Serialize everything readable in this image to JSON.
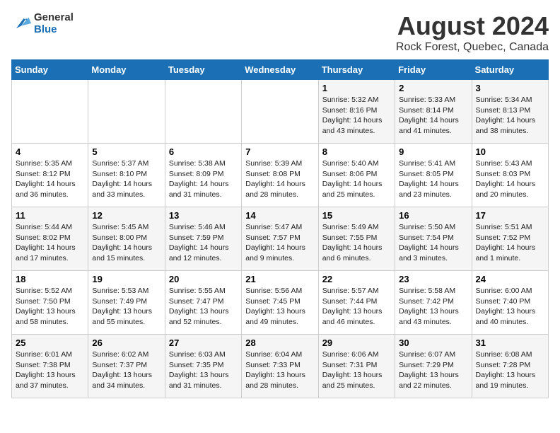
{
  "header": {
    "logo_line1": "General",
    "logo_line2": "Blue",
    "main_title": "August 2024",
    "subtitle": "Rock Forest, Quebec, Canada"
  },
  "days_of_week": [
    "Sunday",
    "Monday",
    "Tuesday",
    "Wednesday",
    "Thursday",
    "Friday",
    "Saturday"
  ],
  "weeks": [
    [
      {
        "day": "",
        "info": ""
      },
      {
        "day": "",
        "info": ""
      },
      {
        "day": "",
        "info": ""
      },
      {
        "day": "",
        "info": ""
      },
      {
        "day": "1",
        "info": "Sunrise: 5:32 AM\nSunset: 8:16 PM\nDaylight: 14 hours\nand 43 minutes."
      },
      {
        "day": "2",
        "info": "Sunrise: 5:33 AM\nSunset: 8:14 PM\nDaylight: 14 hours\nand 41 minutes."
      },
      {
        "day": "3",
        "info": "Sunrise: 5:34 AM\nSunset: 8:13 PM\nDaylight: 14 hours\nand 38 minutes."
      }
    ],
    [
      {
        "day": "4",
        "info": "Sunrise: 5:35 AM\nSunset: 8:12 PM\nDaylight: 14 hours\nand 36 minutes."
      },
      {
        "day": "5",
        "info": "Sunrise: 5:37 AM\nSunset: 8:10 PM\nDaylight: 14 hours\nand 33 minutes."
      },
      {
        "day": "6",
        "info": "Sunrise: 5:38 AM\nSunset: 8:09 PM\nDaylight: 14 hours\nand 31 minutes."
      },
      {
        "day": "7",
        "info": "Sunrise: 5:39 AM\nSunset: 8:08 PM\nDaylight: 14 hours\nand 28 minutes."
      },
      {
        "day": "8",
        "info": "Sunrise: 5:40 AM\nSunset: 8:06 PM\nDaylight: 14 hours\nand 25 minutes."
      },
      {
        "day": "9",
        "info": "Sunrise: 5:41 AM\nSunset: 8:05 PM\nDaylight: 14 hours\nand 23 minutes."
      },
      {
        "day": "10",
        "info": "Sunrise: 5:43 AM\nSunset: 8:03 PM\nDaylight: 14 hours\nand 20 minutes."
      }
    ],
    [
      {
        "day": "11",
        "info": "Sunrise: 5:44 AM\nSunset: 8:02 PM\nDaylight: 14 hours\nand 17 minutes."
      },
      {
        "day": "12",
        "info": "Sunrise: 5:45 AM\nSunset: 8:00 PM\nDaylight: 14 hours\nand 15 minutes."
      },
      {
        "day": "13",
        "info": "Sunrise: 5:46 AM\nSunset: 7:59 PM\nDaylight: 14 hours\nand 12 minutes."
      },
      {
        "day": "14",
        "info": "Sunrise: 5:47 AM\nSunset: 7:57 PM\nDaylight: 14 hours\nand 9 minutes."
      },
      {
        "day": "15",
        "info": "Sunrise: 5:49 AM\nSunset: 7:55 PM\nDaylight: 14 hours\nand 6 minutes."
      },
      {
        "day": "16",
        "info": "Sunrise: 5:50 AM\nSunset: 7:54 PM\nDaylight: 14 hours\nand 3 minutes."
      },
      {
        "day": "17",
        "info": "Sunrise: 5:51 AM\nSunset: 7:52 PM\nDaylight: 14 hours\nand 1 minute."
      }
    ],
    [
      {
        "day": "18",
        "info": "Sunrise: 5:52 AM\nSunset: 7:50 PM\nDaylight: 13 hours\nand 58 minutes."
      },
      {
        "day": "19",
        "info": "Sunrise: 5:53 AM\nSunset: 7:49 PM\nDaylight: 13 hours\nand 55 minutes."
      },
      {
        "day": "20",
        "info": "Sunrise: 5:55 AM\nSunset: 7:47 PM\nDaylight: 13 hours\nand 52 minutes."
      },
      {
        "day": "21",
        "info": "Sunrise: 5:56 AM\nSunset: 7:45 PM\nDaylight: 13 hours\nand 49 minutes."
      },
      {
        "day": "22",
        "info": "Sunrise: 5:57 AM\nSunset: 7:44 PM\nDaylight: 13 hours\nand 46 minutes."
      },
      {
        "day": "23",
        "info": "Sunrise: 5:58 AM\nSunset: 7:42 PM\nDaylight: 13 hours\nand 43 minutes."
      },
      {
        "day": "24",
        "info": "Sunrise: 6:00 AM\nSunset: 7:40 PM\nDaylight: 13 hours\nand 40 minutes."
      }
    ],
    [
      {
        "day": "25",
        "info": "Sunrise: 6:01 AM\nSunset: 7:38 PM\nDaylight: 13 hours\nand 37 minutes."
      },
      {
        "day": "26",
        "info": "Sunrise: 6:02 AM\nSunset: 7:37 PM\nDaylight: 13 hours\nand 34 minutes."
      },
      {
        "day": "27",
        "info": "Sunrise: 6:03 AM\nSunset: 7:35 PM\nDaylight: 13 hours\nand 31 minutes."
      },
      {
        "day": "28",
        "info": "Sunrise: 6:04 AM\nSunset: 7:33 PM\nDaylight: 13 hours\nand 28 minutes."
      },
      {
        "day": "29",
        "info": "Sunrise: 6:06 AM\nSunset: 7:31 PM\nDaylight: 13 hours\nand 25 minutes."
      },
      {
        "day": "30",
        "info": "Sunrise: 6:07 AM\nSunset: 7:29 PM\nDaylight: 13 hours\nand 22 minutes."
      },
      {
        "day": "31",
        "info": "Sunrise: 6:08 AM\nSunset: 7:28 PM\nDaylight: 13 hours\nand 19 minutes."
      }
    ]
  ]
}
